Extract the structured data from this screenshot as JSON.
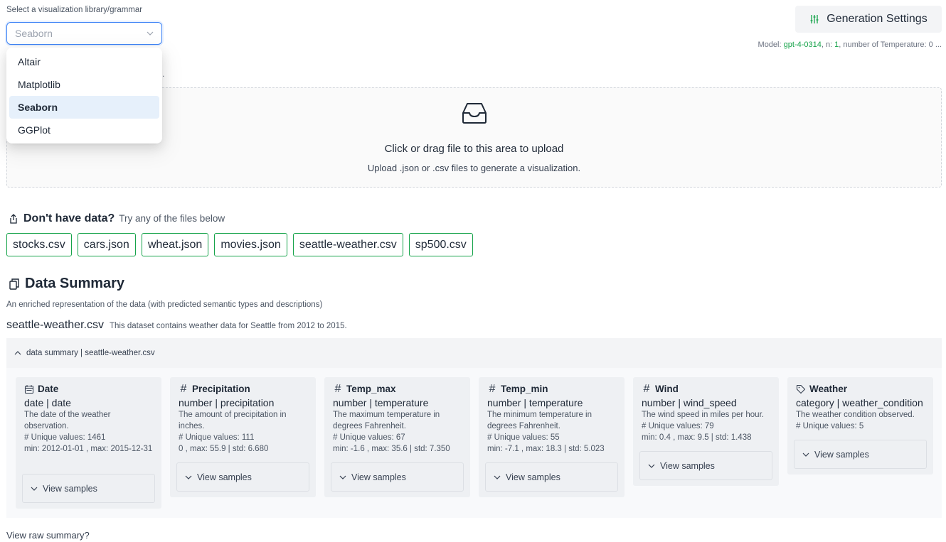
{
  "library": {
    "label": "Select a visualization library/grammar",
    "selected": "Seaborn",
    "options": [
      "Altair",
      "Matplotlib",
      "Seaborn",
      "GGPlot"
    ],
    "hidden_tail": "."
  },
  "settings": {
    "button_label": "Generation Settings",
    "model_prefix": "Model: ",
    "model_name": "gpt-4-0314",
    "n_prefix": ", n: ",
    "n_value": "1",
    "temp_text": ", number of Temperature: 0 ..."
  },
  "upload": {
    "title": "Click or drag file to this area to upload",
    "subtitle": "Upload .json or .csv files to generate a visualization."
  },
  "sample_data": {
    "heading": "Don't have data?",
    "hint": "Try any of the files below",
    "files": [
      "stocks.csv",
      "cars.json",
      "wheat.json",
      "movies.json",
      "seattle-weather.csv",
      "sp500.csv"
    ]
  },
  "summary": {
    "heading": "Data Summary",
    "description": "An enriched representation of the data (with predicted semantic types and descriptions)",
    "file_name": "seattle-weather.csv",
    "file_description": "This dataset contains weather data for Seattle from 2012 to 2015.",
    "collapse_label": "data summary | seattle-weather.csv",
    "view_samples_label": "View samples",
    "fields": [
      {
        "icon": "calendar-icon",
        "name": "Date",
        "type": "date | date",
        "desc": "The date of the weather observation.",
        "unique": "# Unique values: 1461",
        "stats": "min: 2012-01-01 , max: 2015-12-31"
      },
      {
        "icon": "hash-icon",
        "name": "Precipitation",
        "type": "number | precipitation",
        "desc": "The amount of precipitation in inches.",
        "unique": "# Unique values: 111",
        "stats": "0 , max: 55.9 | std: 6.680"
      },
      {
        "icon": "hash-icon",
        "name": "Temp_max",
        "type": "number | temperature",
        "desc": "The maximum temperature in degrees Fahrenheit.",
        "unique": "# Unique values: 67",
        "stats": "min: -1.6 , max: 35.6 | std: 7.350"
      },
      {
        "icon": "hash-icon",
        "name": "Temp_min",
        "type": "number | temperature",
        "desc": "The minimum temperature in degrees Fahrenheit.",
        "unique": "# Unique values: 55",
        "stats": "min: -7.1 , max: 18.3 | std: 5.023"
      },
      {
        "icon": "hash-icon",
        "name": "Wind",
        "type": "number | wind_speed",
        "desc": "The wind speed in miles per hour.",
        "unique": "# Unique values: 79",
        "stats": "min: 0.4 , max: 9.5 | std: 1.438"
      },
      {
        "icon": "tag-icon",
        "name": "Weather",
        "type": "category | weather_condition",
        "desc": "The weather condition observed.",
        "unique": "# Unique values: 5",
        "stats": ""
      }
    ],
    "raw_link": "View raw summary?"
  },
  "colors": {
    "accent_blue": "#3b82f6",
    "accent_green": "#16a34a",
    "panel_gray": "#f3f4f6"
  }
}
